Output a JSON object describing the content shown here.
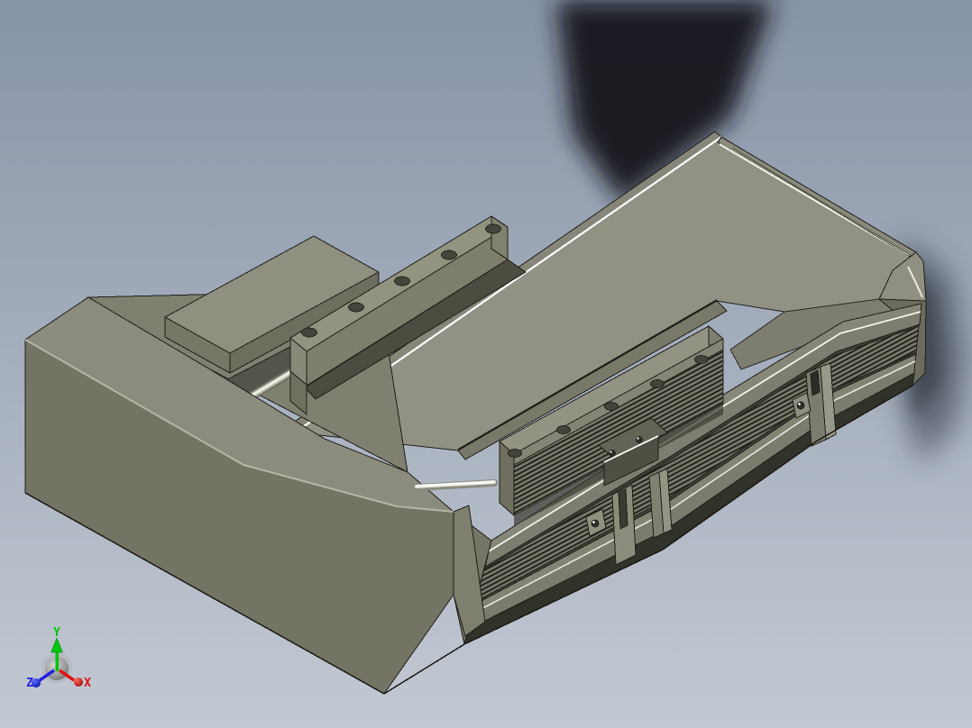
{
  "viewport": {
    "background": {
      "top": "#8794a7",
      "bottom": "#c3c9d3"
    },
    "axis_triad": {
      "labels": {
        "x": "X",
        "y": "Y",
        "z": "Z"
      },
      "colors": {
        "x": "#e01111",
        "y": "#00c60c",
        "z": "#2222e0"
      }
    },
    "model": {
      "top_face_color": "#919284",
      "front_face_color": "#737463",
      "side_face_color": "#7e7f6e",
      "band_light_color": "#868778",
      "band_dark_color": "#3f4035",
      "edge_color": "#1f1f1a",
      "highlight_color": "#ffffff",
      "cast_shadow_color": "#14181e"
    }
  }
}
